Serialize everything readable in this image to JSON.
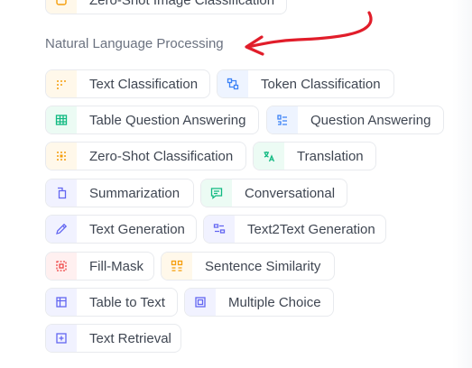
{
  "top_chip": {
    "label": "Zero-Shot Image Classification",
    "color": "#f59e0b",
    "icon": "zero-shot-image-icon"
  },
  "section": {
    "title": "Natural Language Processing"
  },
  "annotation": {
    "color": "#e11d2a"
  },
  "tasks": [
    {
      "label": "Text Classification",
      "icon": "text-classification-icon",
      "color": "#f59e0b"
    },
    {
      "label": "Token Classification",
      "icon": "token-classification-icon",
      "color": "#3b82f6"
    },
    {
      "label": "Table Question Answering",
      "icon": "table-icon",
      "color": "#10b981"
    },
    {
      "label": "Question Answering",
      "icon": "question-answering-icon",
      "color": "#3b82f6"
    },
    {
      "label": "Zero-Shot Classification",
      "icon": "zero-shot-icon",
      "color": "#f59e0b"
    },
    {
      "label": "Translation",
      "icon": "translation-icon",
      "color": "#10b981"
    },
    {
      "label": "Summarization",
      "icon": "summarization-icon",
      "color": "#6366f1"
    },
    {
      "label": "Conversational",
      "icon": "chat-icon",
      "color": "#10b981"
    },
    {
      "label": "Text Generation",
      "icon": "pen-icon",
      "color": "#6366f1"
    },
    {
      "label": "Text2Text Generation",
      "icon": "text2text-icon",
      "color": "#6366f1"
    },
    {
      "label": "Fill-Mask",
      "icon": "fill-mask-icon",
      "color": "#ef4444"
    },
    {
      "label": "Sentence Similarity",
      "icon": "similarity-icon",
      "color": "#f59e0b"
    },
    {
      "label": "Table to Text",
      "icon": "table-to-text-icon",
      "color": "#6366f1"
    },
    {
      "label": "Multiple Choice",
      "icon": "multiple-choice-icon",
      "color": "#6366f1"
    },
    {
      "label": "Text Retrieval",
      "icon": "retrieval-icon",
      "color": "#6366f1"
    }
  ]
}
